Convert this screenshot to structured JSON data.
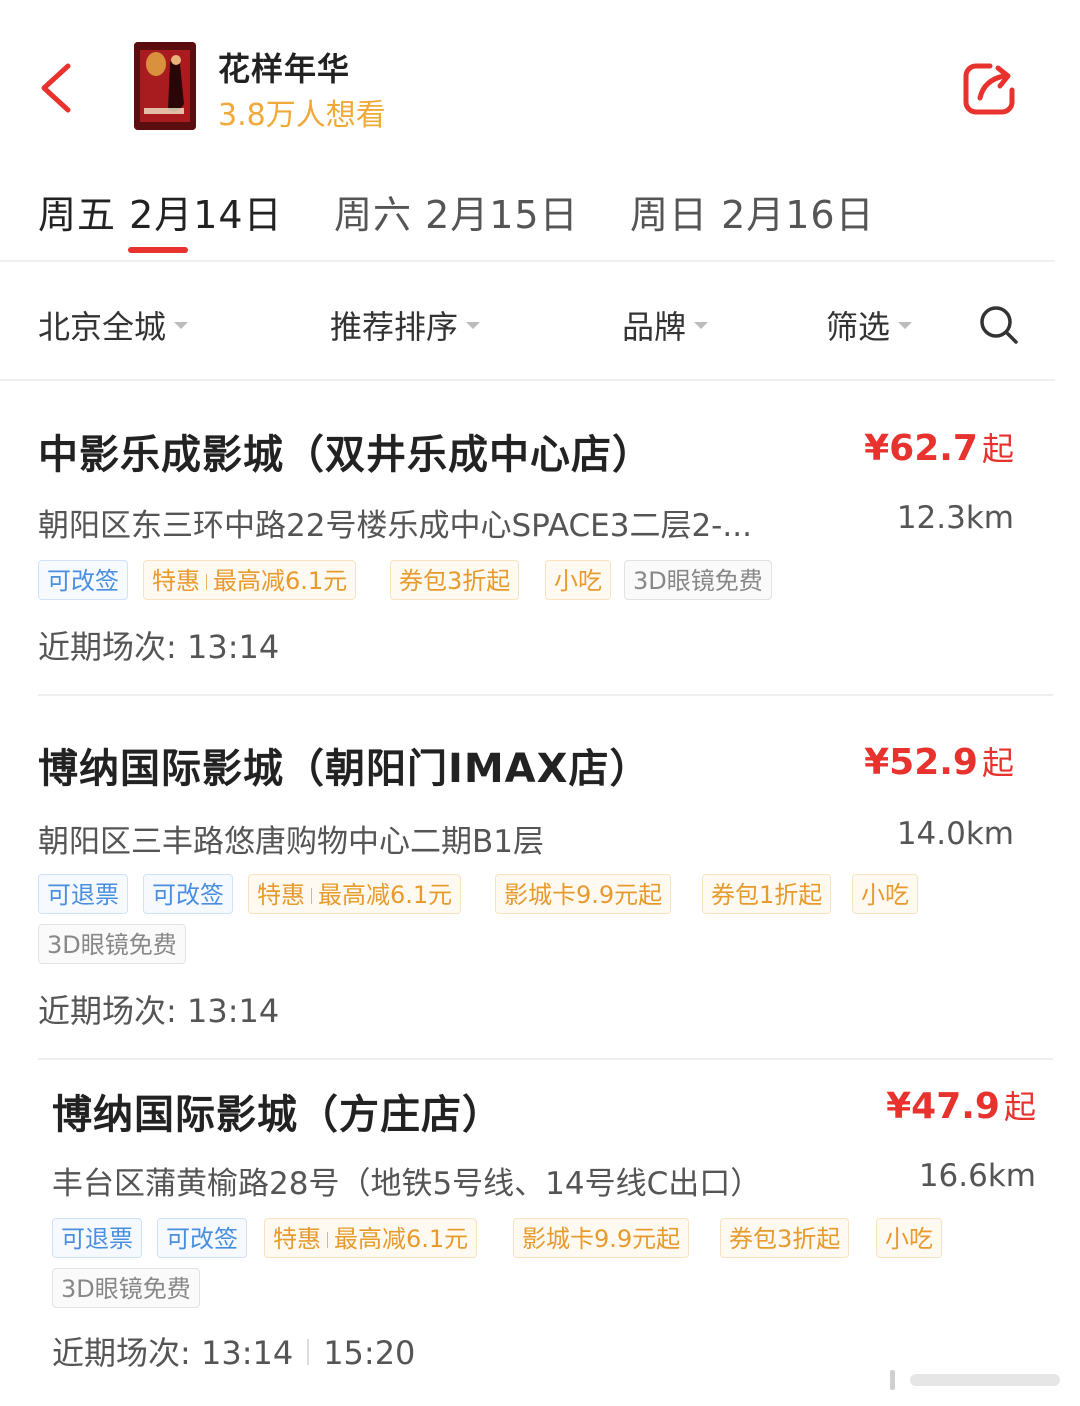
{
  "header": {
    "movie_title": "花样年华",
    "want_count": "3.8万人想看",
    "colors": {
      "accent": "#e8322e",
      "want": "#f1a93a"
    }
  },
  "date_tabs": [
    {
      "label": "周五 2月14日",
      "active": true
    },
    {
      "label": "周六 2月15日",
      "active": false
    },
    {
      "label": "周日 2月16日",
      "active": false
    }
  ],
  "filters": [
    "北京全城",
    "推荐排序",
    "品牌",
    "筛选"
  ],
  "cinemas": [
    {
      "name": "中影乐成影城（双井乐成中心店）",
      "price": "¥62.7",
      "price_suffix": "起",
      "address": "朝阳区东三环中路22号楼乐成中心SPACE3二层2-...",
      "distance": "12.3km",
      "tags": [
        {
          "text": "可改签",
          "style": "blue"
        },
        {
          "text": "特惠",
          "text2": "最高减6.1元",
          "style": "orange"
        },
        {
          "text": "券包3折起",
          "style": "orange"
        },
        {
          "text": "小吃",
          "style": "orange"
        },
        {
          "text": "3D眼镜免费",
          "style": "gray"
        }
      ],
      "showtimes_label": "近期场次:",
      "showtimes": [
        "13:14"
      ]
    },
    {
      "name": "博纳国际影城（朝阳门IMAX店）",
      "price": "¥52.9",
      "price_suffix": "起",
      "address": "朝阳区三丰路悠唐购物中心二期B1层",
      "distance": "14.0km",
      "tags": [
        {
          "text": "可退票",
          "style": "blue"
        },
        {
          "text": "可改签",
          "style": "blue"
        },
        {
          "text": "特惠",
          "text2": "最高减6.1元",
          "style": "orange"
        },
        {
          "text": "影城卡9.9元起",
          "style": "orange"
        },
        {
          "text": "券包1折起",
          "style": "orange"
        },
        {
          "text": "小吃",
          "style": "orange"
        },
        {
          "text": "3D眼镜免费",
          "style": "gray"
        }
      ],
      "showtimes_label": "近期场次:",
      "showtimes": [
        "13:14"
      ]
    },
    {
      "name": "博纳国际影城（方庄店）",
      "price": "¥47.9",
      "price_suffix": "起",
      "address": "丰台区蒲黄榆路28号（地铁5号线、14号线C出口）",
      "distance": "16.6km",
      "tags": [
        {
          "text": "可退票",
          "style": "blue"
        },
        {
          "text": "可改签",
          "style": "blue"
        },
        {
          "text": "特惠",
          "text2": "最高减6.1元",
          "style": "orange"
        },
        {
          "text": "影城卡9.9元起",
          "style": "orange"
        },
        {
          "text": "券包3折起",
          "style": "orange"
        },
        {
          "text": "小吃",
          "style": "orange"
        },
        {
          "text": "3D眼镜免费",
          "style": "gray"
        }
      ],
      "showtimes_label": "近期场次:",
      "showtimes": [
        "13:14",
        "15:20"
      ]
    }
  ]
}
